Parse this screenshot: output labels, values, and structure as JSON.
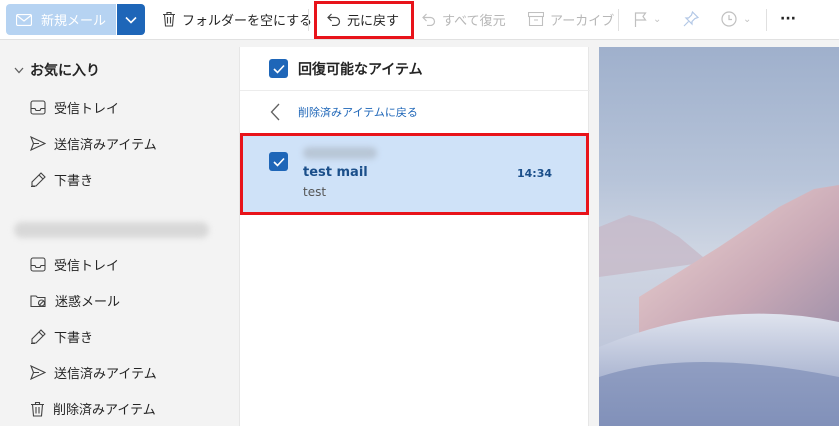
{
  "toolbar": {
    "new_mail": "新規メール",
    "empty_folder": "フォルダーを空にする",
    "undo": "元に戻す",
    "restore_all": "すべて復元",
    "archive": "アーカイブ",
    "more": "···"
  },
  "sidebar": {
    "favorites_label": "お気に入り",
    "favorites": [
      {
        "label": "受信トレイ",
        "icon": "inbox-icon"
      },
      {
        "label": "送信済みアイテム",
        "icon": "send-icon"
      },
      {
        "label": "下書き",
        "icon": "draft-icon"
      }
    ],
    "account_folders": [
      {
        "label": "受信トレイ",
        "icon": "inbox-icon"
      },
      {
        "label": "迷惑メール",
        "icon": "junk-icon"
      },
      {
        "label": "下書き",
        "icon": "draft-icon"
      },
      {
        "label": "送信済みアイテム",
        "icon": "send-icon"
      },
      {
        "label": "削除済みアイテム",
        "icon": "trash-icon"
      }
    ]
  },
  "list": {
    "header": "回復可能なアイテム",
    "back_link": "削除済みアイテムに戻る",
    "messages": [
      {
        "subject": "test mail",
        "time": "14:34",
        "preview": "test",
        "selected": true
      }
    ]
  },
  "colors": {
    "accent": "#1e66b8",
    "highlight": "#e8131a",
    "selected_row": "#cfe2f8"
  }
}
